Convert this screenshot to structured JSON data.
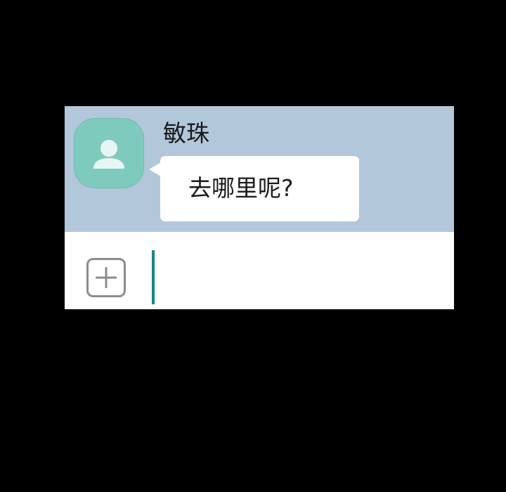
{
  "chat": {
    "sender_name": "敏珠",
    "message_text": "去哪里呢?",
    "avatar_icon": "person-icon"
  },
  "composer": {
    "add_icon": "plus-square-icon",
    "input_value": "",
    "input_placeholder": ""
  },
  "colors": {
    "background": "#000000",
    "message_area": "#b2c7d9",
    "avatar": "#7ecbbd",
    "bubble": "#ffffff",
    "caret": "#128c7e",
    "icon_gray": "#8a8d92"
  }
}
